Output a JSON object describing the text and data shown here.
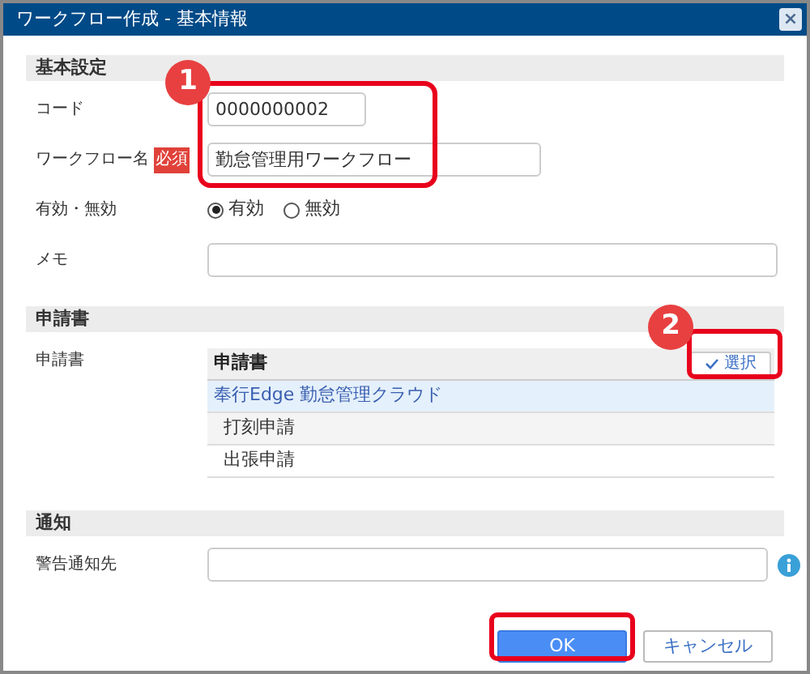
{
  "window": {
    "title": "ワークフロー作成 - 基本情報",
    "close": "×"
  },
  "sections": [
    {
      "title": "基本設定",
      "fields": [
        {
          "kind": "text",
          "label": "コード",
          "value": "0000000002"
        },
        {
          "kind": "text",
          "label": "ワークフロー名",
          "badge": "必須",
          "value": "勤怠管理用ワークフロー"
        },
        {
          "kind": "radio",
          "label": "有効・無効",
          "options": [
            {
              "label": "有効",
              "selected": true
            },
            {
              "label": "無効",
              "selected": false
            }
          ]
        },
        {
          "kind": "text",
          "label": "メモ"
        }
      ]
    },
    {
      "title": "申請書",
      "fields": [
        {
          "kind": "table",
          "label": "申請書",
          "header": "申請書",
          "button": "選択",
          "groups": [
            {
              "label": "奉行Edge 勤怠管理クラウド",
              "children": [
                {
                  "label": "打刻申請"
                },
                {
                  "label": "出張申請"
                }
              ]
            }
          ]
        }
      ]
    },
    {
      "title": "通知",
      "fields": [
        {
          "kind": "text",
          "label": "警告通知先",
          "info": true
        }
      ]
    }
  ],
  "buttons": [
    {
      "label": "OK",
      "primary": true
    },
    {
      "label": "キャンセル",
      "primary": false
    }
  ],
  "callouts": [
    {
      "number": "1"
    },
    {
      "number": "2"
    }
  ]
}
